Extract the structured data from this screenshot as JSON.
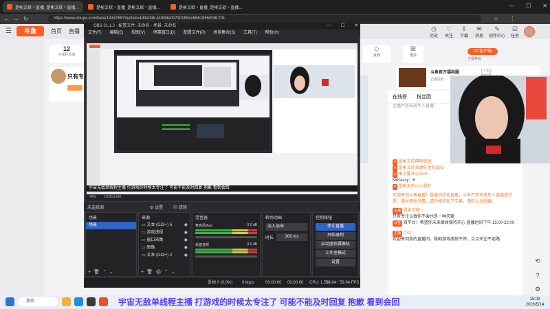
{
  "browser": {
    "tabs": [
      {
        "title": "是彬文欸丶直播_是彬文欸丶直播..."
      },
      {
        "title": "是彬文欸丶直播_是彬文欸丶直播..."
      },
      {
        "title": "是彬文欸丶直播_是彬文欸丶直播..."
      }
    ],
    "url": "https://www.douyu.com/beta/1334765?dyshid=4d0e046-41869e00790185ce56818550091701"
  },
  "douyu": {
    "logo": "斗鱼",
    "nav": [
      "首页",
      "直播",
      "分类",
      "游戏"
    ],
    "header_icons": [
      {
        "icon": "history-icon",
        "label": "历史"
      },
      {
        "icon": "follow-icon",
        "label": "关注"
      },
      {
        "icon": "download-icon",
        "label": "下载"
      },
      {
        "icon": "message-icon",
        "label": "消息"
      },
      {
        "icon": "creator-icon",
        "label": "创作中心"
      },
      {
        "icon": "task-icon",
        "label": "任务"
      }
    ],
    "level_num": "12",
    "level_label": "主播经验值",
    "streamer_short": "只有专",
    "pc_client": "PC客户端",
    "level_right": "主播等级",
    "ad_title": "斗鱼官方福利服",
    "ad_badge": "广告",
    "ad_sub": "正版授权 ...",
    "vip_label": "贵族",
    "more_label": "更多"
  },
  "obs": {
    "title": "OBS 31.1.2 - 配置文件: 未命名 - 场景: 未命名",
    "menu": [
      "文件(F)",
      "编辑(E)",
      "视图(V)",
      "停靠窗口(D)",
      "配置文件(P)",
      "场景集合(S)",
      "工具(T)",
      "帮助(H)"
    ],
    "caption": "宇宙无敌单线程主播 打游戏的时候太专注了 可能不能及时回复 抱歉 看到会回",
    "source_bar": "未选择源",
    "settings_btn": "设置",
    "filter_btn": "滤镜",
    "docks": {
      "scenes": "场景",
      "sources": "来源",
      "mixer": "混音器",
      "transitions": "转场动画",
      "controls": "控制按钮"
    },
    "scenes": [
      "场景"
    ],
    "sources": [
      "文本 (GDI+) 5",
      "游戏进程",
      "窗口采集",
      "图像",
      "文本 (GDI+) 2"
    ],
    "mixer": [
      {
        "name": "麦克风/Aux",
        "db": "0.0 dB"
      },
      {
        "name": "桌面音频",
        "db": "0.0 dB"
      }
    ],
    "transition_type": "淡入淡出",
    "duration_label": "时长",
    "duration_value": "300 ms",
    "controls": [
      "停止直播",
      "开始录制",
      "启动虚拟摄像机",
      "工作室模式",
      "设置"
    ],
    "status": {
      "dropped": "丢帧 0 (0.0%)",
      "kbps": "0 kbps",
      "live_time": "00:00:00",
      "rec_time": "00:00:00",
      "cpu": "CPU: 1.5%",
      "fps": "59.94 / 59.94 FPS"
    },
    "zoom": "48%",
    "res": "1920x1080"
  },
  "chat": {
    "tabs": [
      "在线榜",
      "粉丝团"
    ],
    "header": "主播严禁未成年人直播",
    "lines": [
      {
        "user": "是彬文的隔壁邻居",
        "text": ""
      },
      {
        "user": "是彬文的关键先生的OvO",
        "text": ""
      },
      {
        "user": "彬文要开心OvO",
        "text": ""
      },
      {
        "user": "是彬文的小小星吖",
        "text": ""
      }
    ],
    "notice": "欢迎来到斗鱼直播！直播间绿色直播，斗鱼严禁未成年人直播或打赏，倡导理性消费，请勿相信私下交易，谨防上当受骗。",
    "level_user": "MrKassy：6",
    "anchor_tag": "主播",
    "anchor_name": "是彬文欸丶",
    "anchor_msg": "只有专注认真你不会也是一种天赋",
    "announce_tag": "公告",
    "announce_msg": "双平台：希望你未来继续保持开心 直播时间下午 15:00-22:00",
    "cs_tag": "主播",
    "cs_name": "CS2",
    "welcome": "欢迎来到我的直播间，稳剧游戏成就不停，点点关注不迷路"
  },
  "taskbar": {
    "search_placeholder": "搜索",
    "time": "15:08",
    "date": "2026/5/14"
  },
  "overlay_caption": "宇宙无敌单线程主播 打游戏的时候太专注了 可能不能及时回复 抱歉 看到会回"
}
